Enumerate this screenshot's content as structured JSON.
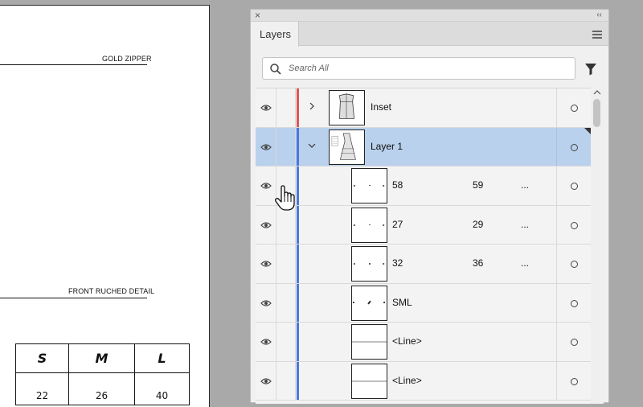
{
  "artboard": {
    "label_top": "GOLD ZIPPER",
    "label_mid": "FRONT RUCHED DETAIL",
    "size_table": {
      "headers": [
        "S",
        "M",
        "L"
      ],
      "values": [
        "22",
        "26",
        "40"
      ]
    }
  },
  "panel": {
    "close_glyph": "×",
    "collapse_glyph": "‹‹",
    "tab_label": "Layers",
    "menu_icon": "hamburger-menu-icon",
    "search": {
      "placeholder": "Search All",
      "value": ""
    },
    "filter_icon": "filter-icon",
    "colors": {
      "inset_bar": "#e05555",
      "layer1_bar": "#4a78e0",
      "selected_row": "#b9d1ec"
    },
    "layers": [
      {
        "name": "Inset",
        "expanded": false,
        "selected": false,
        "level": 0,
        "col2": "",
        "col3": ""
      },
      {
        "name": "Layer 1",
        "expanded": true,
        "selected": true,
        "level": 0,
        "col2": "",
        "col3": ""
      },
      {
        "name": "58",
        "level": 1,
        "col2": "59",
        "col3": "..."
      },
      {
        "name": "27",
        "level": 1,
        "col2": "29",
        "col3": "..."
      },
      {
        "name": "32",
        "level": 1,
        "col2": "36",
        "col3": "..."
      },
      {
        "name": "SML",
        "level": 1,
        "col2": "",
        "col3": ""
      },
      {
        "name": "<Line>",
        "level": 1,
        "col2": "",
        "col3": ""
      },
      {
        "name": "<Line>",
        "level": 1,
        "col2": "",
        "col3": ""
      }
    ]
  }
}
